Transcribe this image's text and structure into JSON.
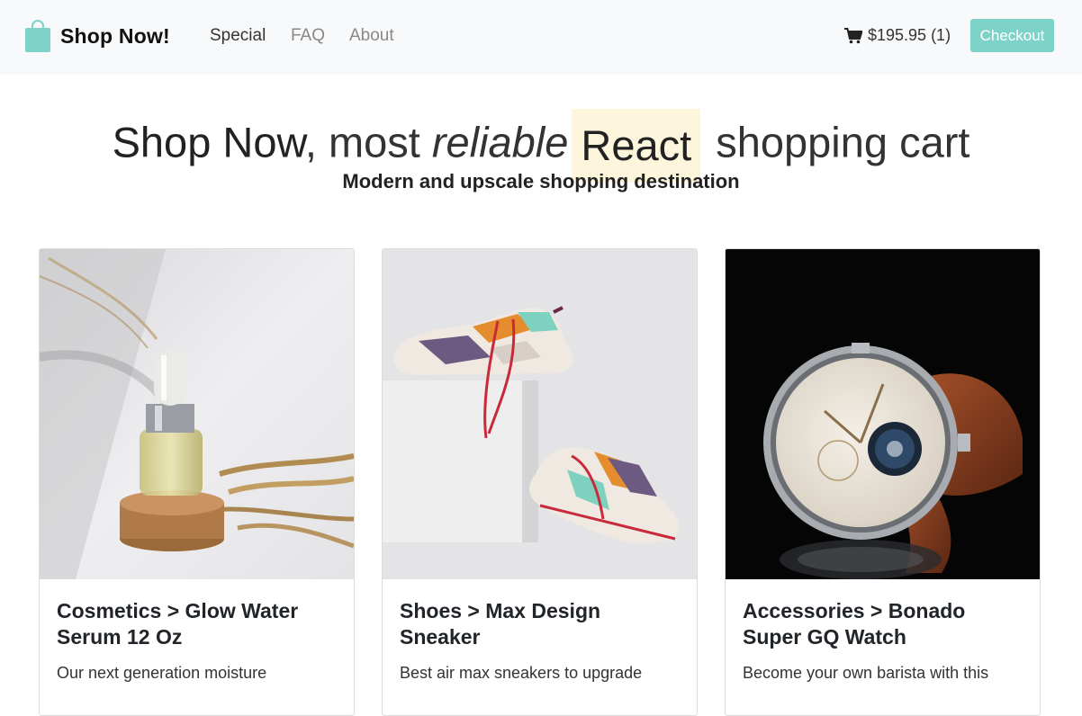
{
  "nav": {
    "brand": "Shop Now!",
    "links": [
      {
        "label": "Special"
      },
      {
        "label": "FAQ"
      },
      {
        "label": "About"
      }
    ],
    "cart_summary": "$195.95 (1)",
    "checkout_label": "Checkout"
  },
  "hero": {
    "part1": "Shop Now",
    "part2": ", most ",
    "part3": "reliable",
    "part4": "React",
    "part5": " shopping cart",
    "subtitle": "Modern and upscale shopping destination"
  },
  "products": [
    {
      "title": "Cosmetics > Glow Water Serum 12 Oz",
      "description": "Our next generation moisture"
    },
    {
      "title": "Shoes > Max Design Sneaker",
      "description": "Best air max sneakers to upgrade"
    },
    {
      "title": "Accessories > Bonado Super GQ Watch",
      "description": "Become your own barista with this"
    }
  ],
  "colors": {
    "accent": "#7dd3c8",
    "navbar_bg": "#f8f9fa",
    "highlight": "#fdf6dc"
  },
  "icons": {
    "brand": "shopping-bag-icon",
    "cart": "cart-icon"
  }
}
